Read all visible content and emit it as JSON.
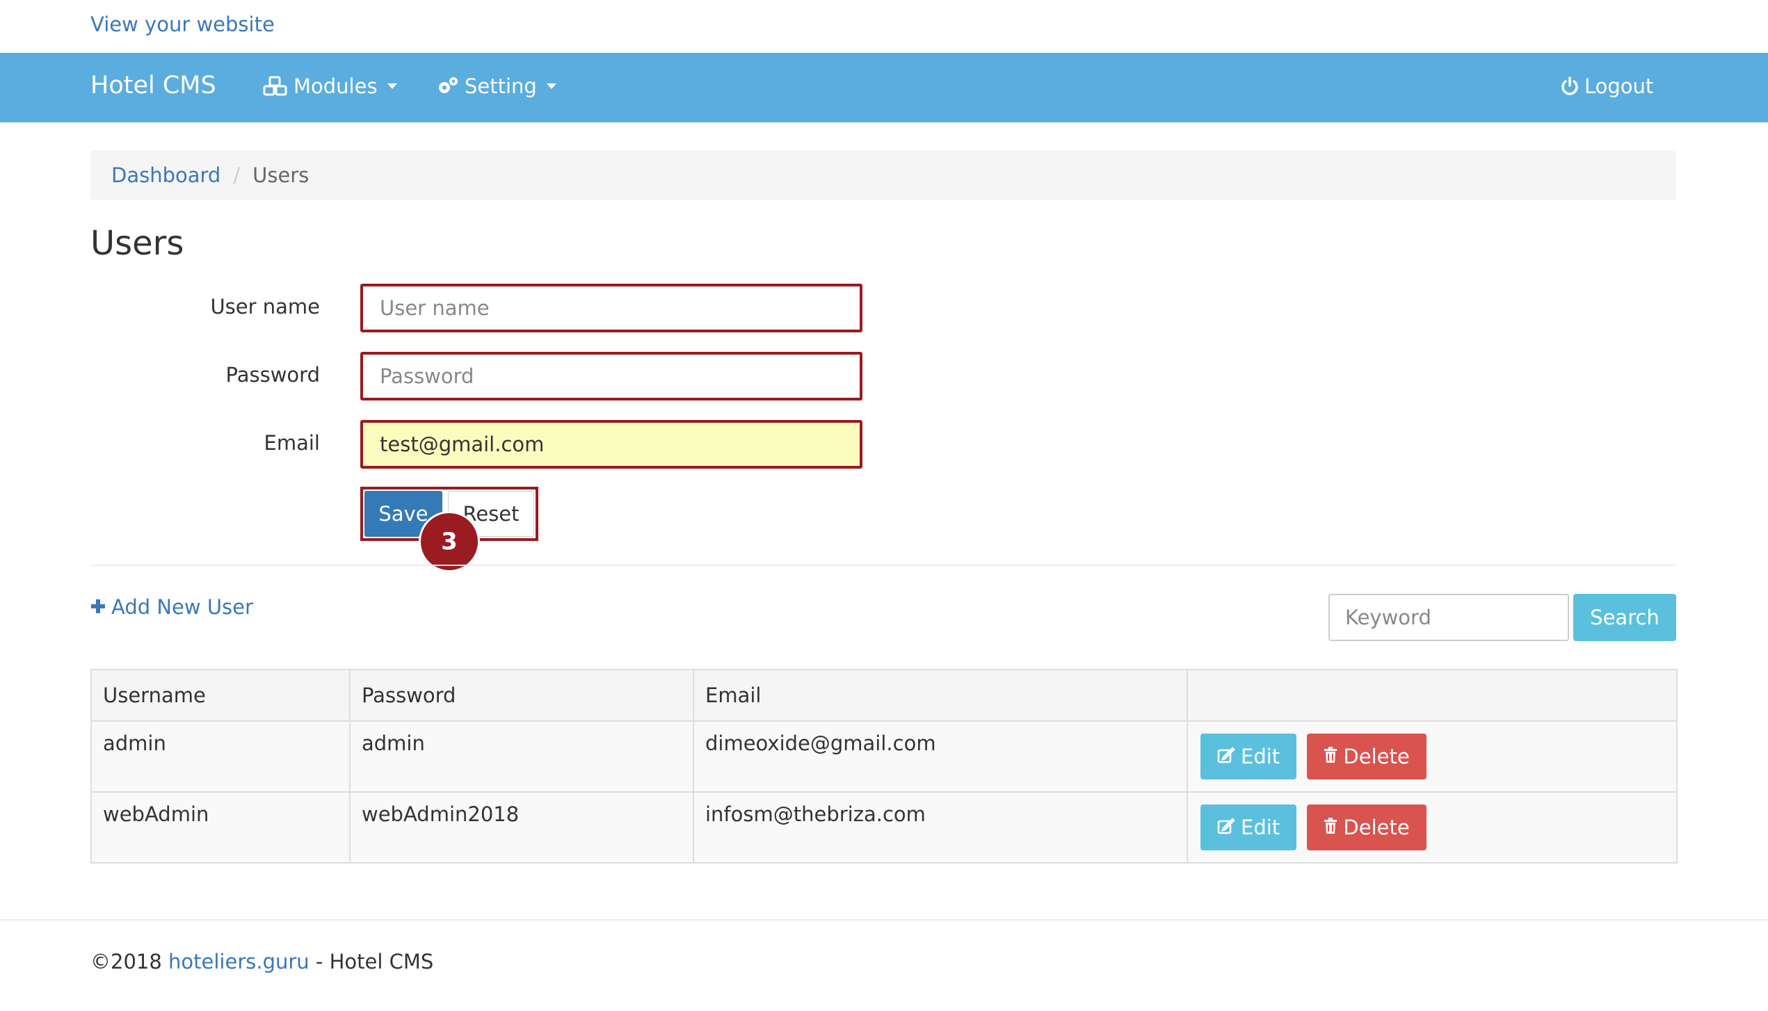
{
  "top_link": "View your website",
  "navbar": {
    "brand": "Hotel CMS",
    "modules": "Modules",
    "setting": "Setting",
    "logout": "Logout",
    "bg_color": "#5aadde",
    "icons": [
      "cubes-icon",
      "gears-icon",
      "power-icon"
    ]
  },
  "breadcrumb": {
    "home": "Dashboard",
    "separator": "/",
    "current": "Users"
  },
  "page_title": "Users",
  "form": {
    "username_label": "User name",
    "username_placeholder": "User name",
    "password_label": "Password",
    "password_placeholder": "Password",
    "email_label": "Email",
    "email_value": "test@gmail.com",
    "save": "Save",
    "reset": "Reset",
    "highlight_color": "#9a1b20"
  },
  "step_badge": "3",
  "add_user": "Add New User",
  "search": {
    "placeholder": "Keyword",
    "button": "Search"
  },
  "table": {
    "headers": [
      "Username",
      "Password",
      "Email",
      ""
    ],
    "rows": [
      {
        "username": "admin",
        "password": "admin",
        "email": "dimeoxide@gmail.com"
      },
      {
        "username": "webAdmin",
        "password": "webAdmin2018",
        "email": "infosm@thebriza.com"
      }
    ],
    "edit": "Edit",
    "delete": "Delete"
  },
  "footer": {
    "prefix": "©2018",
    "link": "hoteliers.guru",
    "suffix": "- Hotel CMS"
  }
}
